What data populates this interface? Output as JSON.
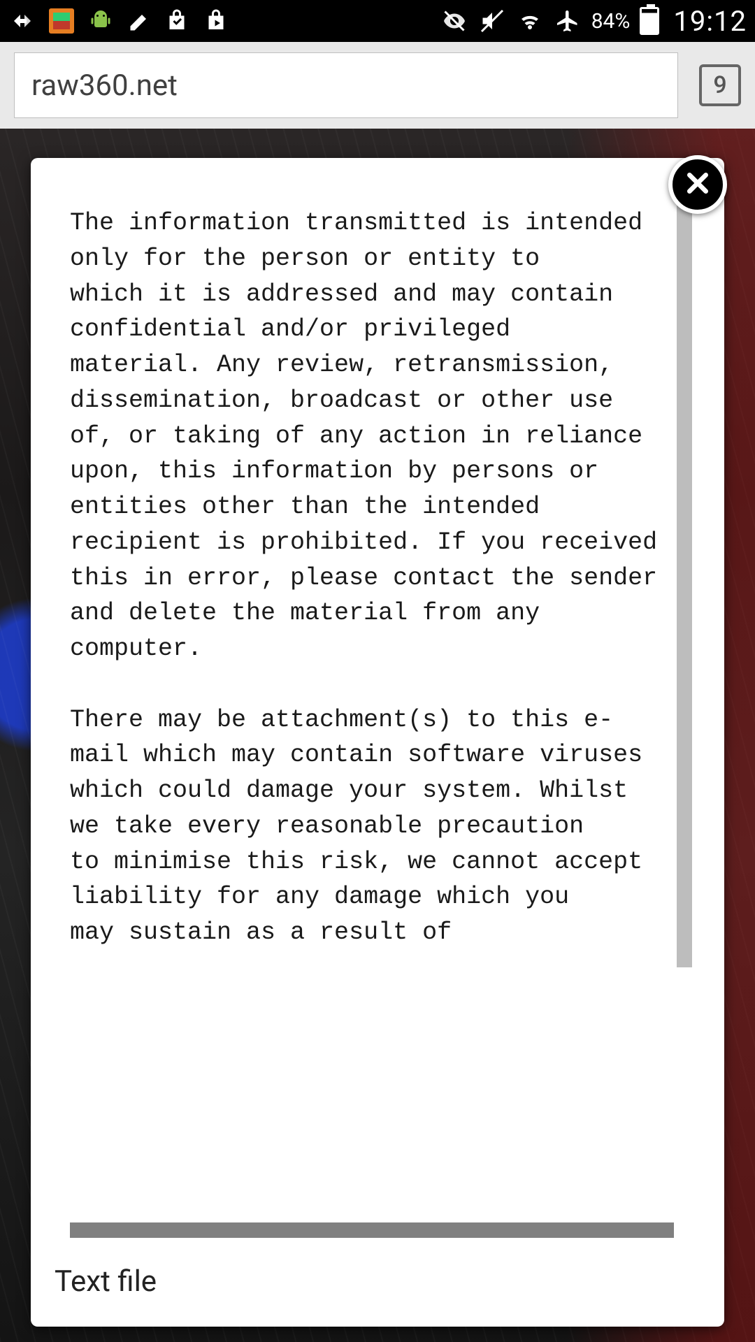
{
  "statusbar": {
    "battery_pct": "84%",
    "clock": "19:12"
  },
  "browser": {
    "url": "raw360.net",
    "tab_count": "9"
  },
  "modal": {
    "text": "The information transmitted is intended only for the person or entity to\nwhich it is addressed and may contain confidential and/or privileged\nmaterial. Any review, retransmission, dissemination, broadcast or other use\nof, or taking of any action in reliance upon, this information by persons or\nentities other than the intended recipient is prohibited. If you received\nthis in error, please contact the sender and delete the material from any\ncomputer.\n\nThere may be attachment(s) to this e-mail which may contain software viruses\nwhich could damage your system. Whilst we take every reasonable precaution\nto minimise this risk, we cannot accept liability for any damage which you\nmay sustain as a result of",
    "footer_label": "Text file"
  }
}
